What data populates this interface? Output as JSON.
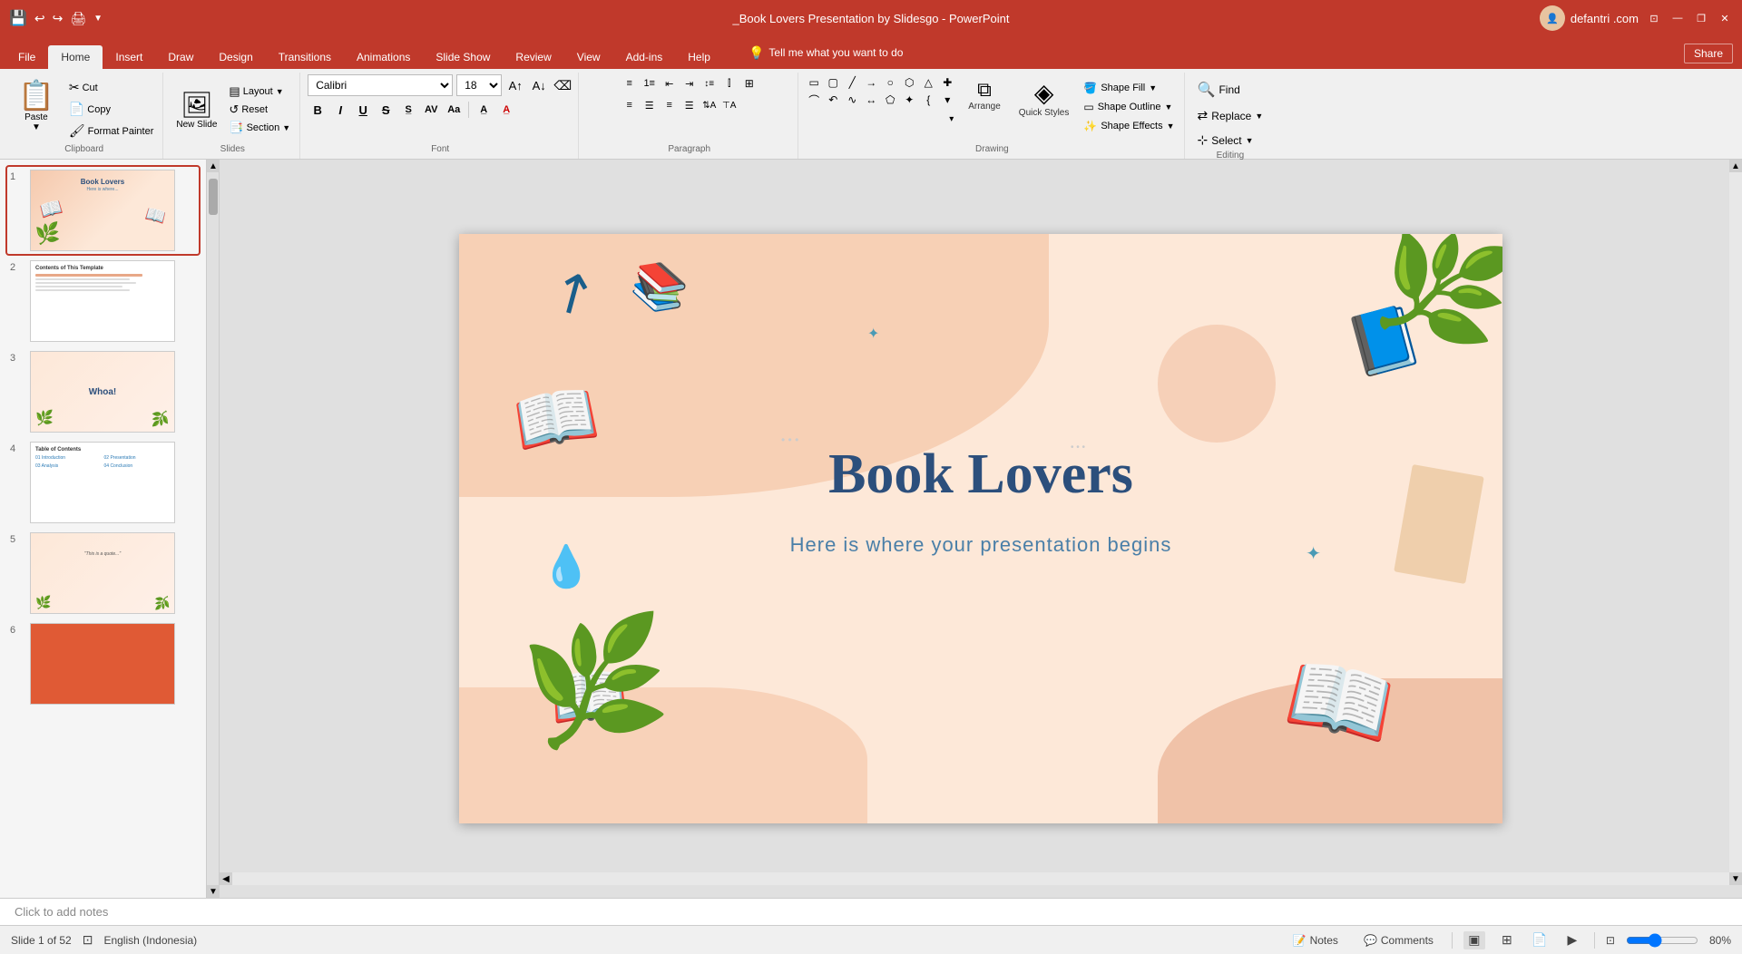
{
  "window": {
    "title": "_Book Lovers Presentation by Slidesgo - PowerPoint",
    "user": "defantri .com",
    "min": "—",
    "max": "❐",
    "close": "✕"
  },
  "tabs": {
    "items": [
      "File",
      "Home",
      "Insert",
      "Draw",
      "Design",
      "Transitions",
      "Animations",
      "Slide Show",
      "Review",
      "View",
      "Add-ins",
      "Help"
    ]
  },
  "tell_me": {
    "placeholder": "Tell me what you want to do"
  },
  "share": {
    "label": "Share"
  },
  "clipboard": {
    "paste_label": "Paste",
    "cut_label": "Cut",
    "copy_label": "Copy",
    "format_painter_label": "Format Painter",
    "group_label": "Clipboard"
  },
  "slides_group": {
    "new_slide_label": "New Slide",
    "layout_label": "Layout",
    "reset_label": "Reset",
    "section_label": "Section",
    "group_label": "Slides"
  },
  "font_group": {
    "font_name": "Calibri",
    "font_size": "18",
    "increase_label": "Increase Font Size",
    "decrease_label": "Decrease Font Size",
    "clear_label": "Clear Formatting",
    "bold_label": "Bold",
    "italic_label": "Italic",
    "underline_label": "Underline",
    "strikethrough_label": "Strikethrough",
    "shadow_label": "Text Shadow",
    "spacing_label": "Character Spacing",
    "case_label": "Change Case",
    "font_color_label": "Font Color",
    "highlight_label": "Highlight",
    "group_label": "Font"
  },
  "paragraph_group": {
    "bullets_label": "Bullets",
    "numbering_label": "Numbering",
    "decrease_indent": "Decrease Indent",
    "increase_indent": "Increase Indent",
    "line_spacing": "Line Spacing",
    "columns_label": "Columns",
    "align_left": "Align Left",
    "align_center": "Center",
    "align_right": "Align Right",
    "justify": "Justify",
    "text_direction": "Text Direction",
    "align_text": "Align Text",
    "smartart": "Convert to SmartArt",
    "group_label": "Paragraph"
  },
  "drawing_group": {
    "arrange_label": "Arrange",
    "quick_styles_label": "Quick Styles",
    "shape_fill_label": "Shape Fill",
    "shape_outline_label": "Shape Outline",
    "shape_effects_label": "Shape Effects",
    "group_label": "Drawing"
  },
  "editing_group": {
    "find_label": "Find",
    "replace_label": "Replace",
    "select_label": "Select",
    "group_label": "Editing"
  },
  "slide_panel": {
    "slides": [
      {
        "number": "1",
        "type": "title",
        "active": true
      },
      {
        "number": "2",
        "type": "content"
      },
      {
        "number": "3",
        "type": "section"
      },
      {
        "number": "4",
        "type": "toc"
      },
      {
        "number": "5",
        "type": "quote"
      },
      {
        "number": "6",
        "type": "accent"
      }
    ]
  },
  "main_slide": {
    "title": "Book Lovers",
    "subtitle": "Here is where your presentation begins"
  },
  "notes": {
    "placeholder": "Click to add notes"
  },
  "statusbar": {
    "slide_info": "Slide 1 of 52",
    "language": "English (Indonesia)",
    "notes_label": "Notes",
    "comments_label": "Comments",
    "zoom_level": "80%"
  }
}
